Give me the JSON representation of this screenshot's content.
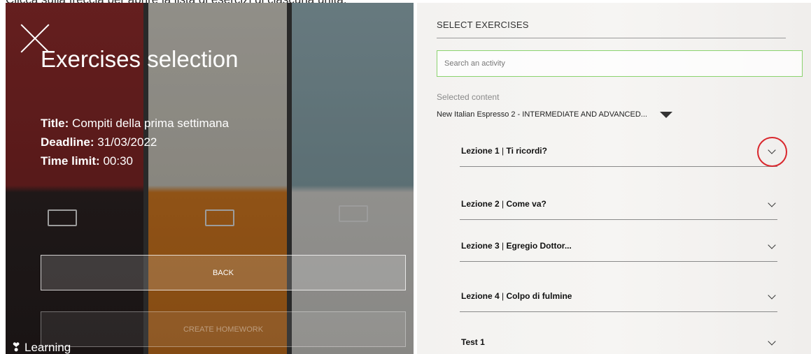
{
  "instruction": "Clicca sulla freccia per aprire la lista di esercizi di ciascuna unità.",
  "left": {
    "title": "Exercises selection",
    "title_label": "Title:",
    "title_value": "Compiti della prima settimana",
    "deadline_label": "Deadline:",
    "deadline_value": "31/03/2022",
    "time_limit_label": "Time limit:",
    "time_limit_value": "00:30",
    "back_label": "BACK",
    "create_label": "CREATE HOMEWORK",
    "brand": "Learning"
  },
  "right": {
    "section_title": "SELECT EXERCISES",
    "search_placeholder": "Search an activity",
    "selected_label": "Selected content",
    "course": "New Italian Espresso 2 - INTERMEDIATE AND ADVANCED...",
    "lessons": [
      {
        "number": "Lezione 1",
        "title": "Ti ricordi?"
      },
      {
        "number": "Lezione 2",
        "title": "Come va?"
      },
      {
        "number": "Lezione 3",
        "title": "Egregio Dottor..."
      },
      {
        "number": "Lezione 4",
        "title": "Colpo di fulmine"
      },
      {
        "number": "Test 1",
        "title": ""
      }
    ]
  },
  "colors": {
    "search_border": "#8bd36e",
    "highlight_ring": "#d9272d"
  }
}
